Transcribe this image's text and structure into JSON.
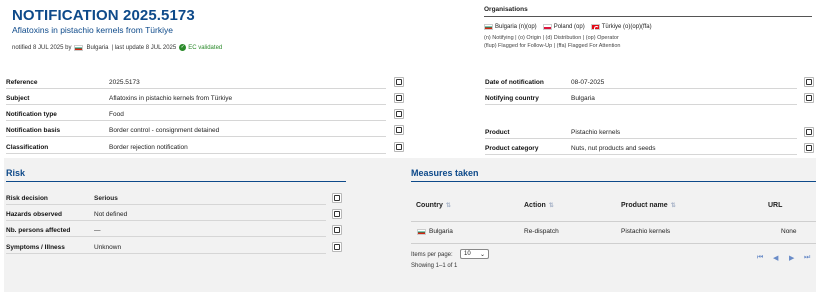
{
  "header": {
    "title": "NOTIFICATION 2025.5173",
    "subtitle": "Aflatoxins in pistachio kernels from Türkiye",
    "notified_prefix": "notified 8 JUL 2025 by",
    "notified_country": "Bulgaria",
    "notified_suffix": "| last update 8 JUL 2025",
    "validated": "EC validated"
  },
  "organisations": {
    "title": "Organisations",
    "countries": [
      {
        "flag": "bulgaria-flag",
        "label": "Bulgaria (n)(op)"
      },
      {
        "flag": "poland-flag",
        "label": "Poland (op)"
      },
      {
        "flag": "turkiye-flag",
        "label": "Türkiye (o)(op)(ffa)"
      }
    ],
    "legend_line1": "(n) Notifying | (o) Origin | (d) Distribution | (op) Operator",
    "legend_line2": "(flup) Flagged for Follow-Up | (ffa) Flagged For Attention"
  },
  "details_left": [
    {
      "label": "Reference",
      "value": "2025.5173"
    },
    {
      "label": "Subject",
      "value": "Aflatoxins in pistachio kernels from Türkiye"
    },
    {
      "label": "Notification type",
      "value": "Food"
    },
    {
      "label": "Notification basis",
      "value": "Border control - consignment detained"
    },
    {
      "label": "Classification",
      "value": "Border rejection notification"
    }
  ],
  "details_right": [
    {
      "label": "Date of notification",
      "value": "08-07-2025"
    },
    {
      "label": "Notifying country",
      "value": "Bulgaria"
    },
    {
      "label": "Product",
      "value": "Pistachio kernels"
    },
    {
      "label": "Product category",
      "value": "Nuts, nut products and seeds"
    }
  ],
  "risk": {
    "title": "Risk",
    "rows": [
      {
        "label": "Risk decision",
        "value": "Serious"
      },
      {
        "label": "Hazards observed",
        "value": "Not defined"
      },
      {
        "label": "Nb. persons affected",
        "value": "—"
      },
      {
        "label": "Symptoms / Illness",
        "value": "Unknown"
      }
    ]
  },
  "measures": {
    "title": "Measures taken",
    "columns": [
      "Country",
      "Action",
      "Product name",
      "URL"
    ],
    "rows": [
      {
        "country": "Bulgaria",
        "action": "Re-dispatch",
        "product": "Pistachio kernels",
        "url": "None"
      }
    ],
    "items_per_page_label": "Items per page:",
    "items_per_page": "10",
    "showing": "Showing 1–1 of 1"
  },
  "colors": {
    "accent": "#0e4a8a",
    "serious": "#c41a1a",
    "validated": "#2a8a2a"
  }
}
